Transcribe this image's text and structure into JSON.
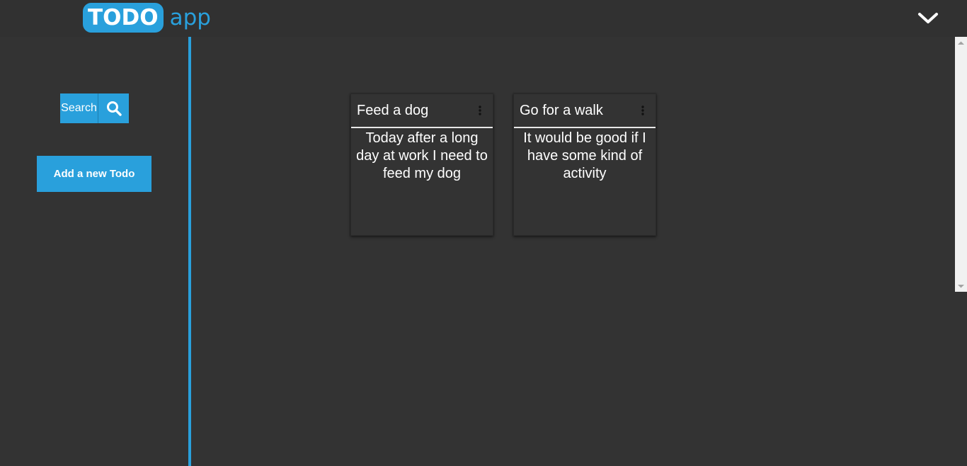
{
  "header": {
    "logo_badge": "TODO",
    "logo_text": "app",
    "menu_icon": "chevron-down-icon"
  },
  "sidebar": {
    "search_label": "Search",
    "search_icon": "search-icon",
    "add_button_label": "Add a new Todo"
  },
  "todos": [
    {
      "title": "Feed a dog",
      "body": "Today after a long day at work I need to feed my dog",
      "menu_icon": "more-vertical-icon"
    },
    {
      "title": "Go for a walk",
      "body": "It would be good if I have some kind of activity",
      "menu_icon": "more-vertical-icon"
    }
  ],
  "colors": {
    "accent": "#29a0dc",
    "background": "#333333",
    "header": "#313131",
    "text": "#ffffff"
  }
}
